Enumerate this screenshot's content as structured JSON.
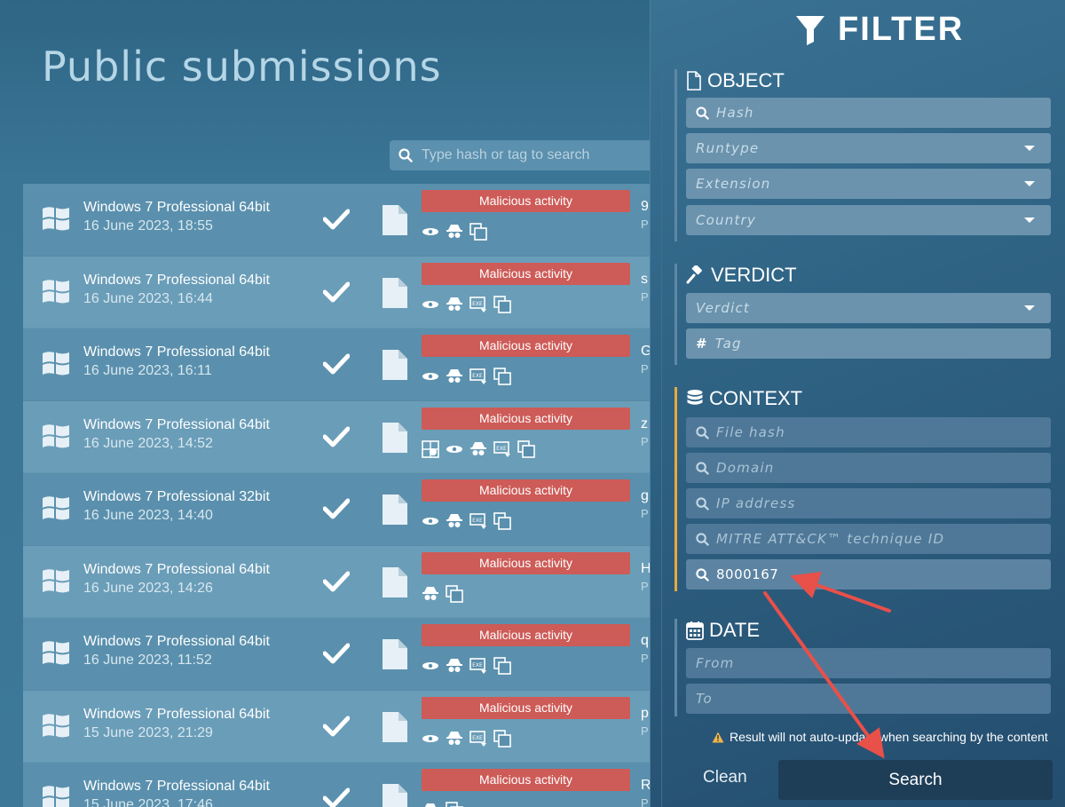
{
  "page": {
    "title": "Public submissions",
    "search_placeholder": "Type hash or tag to search"
  },
  "submissions": [
    {
      "os": "Windows 7 Professional 64bit",
      "date": "16 June 2023, 18:55",
      "verdict": "Malicious activity",
      "name_prefix": "9",
      "sub_prefix": "P",
      "tags": [
        "eye-icon",
        "spy-icon",
        "copy-icon"
      ]
    },
    {
      "os": "Windows 7 Professional 64bit",
      "date": "16 June 2023, 16:44",
      "verdict": "Malicious activity",
      "name_prefix": "s",
      "sub_prefix": "P",
      "tags": [
        "eye-icon",
        "spy-icon",
        "exe-icon",
        "copy-icon"
      ]
    },
    {
      "os": "Windows 7 Professional 64bit",
      "date": "16 June 2023, 16:11",
      "verdict": "Malicious activity",
      "name_prefix": "G",
      "sub_prefix": "P",
      "tags": [
        "eye-icon",
        "spy-icon",
        "exe-icon",
        "copy-icon"
      ]
    },
    {
      "os": "Windows 7 Professional 64bit",
      "date": "16 June 2023, 14:52",
      "verdict": "Malicious activity",
      "name_prefix": "z",
      "sub_prefix": "P",
      "tags": [
        "network-icon",
        "eye-icon",
        "spy-icon",
        "exe-icon",
        "copy-icon"
      ]
    },
    {
      "os": "Windows 7 Professional 32bit",
      "date": "16 June 2023, 14:40",
      "verdict": "Malicious activity",
      "name_prefix": "g",
      "sub_prefix": "P",
      "tags": [
        "eye-icon",
        "spy-icon",
        "exe-icon",
        "copy-icon"
      ]
    },
    {
      "os": "Windows 7 Professional 64bit",
      "date": "16 June 2023, 14:26",
      "verdict": "Malicious activity",
      "name_prefix": "H",
      "sub_prefix": "P",
      "tags": [
        "spy-icon",
        "copy-icon"
      ]
    },
    {
      "os": "Windows 7 Professional 64bit",
      "date": "16 June 2023, 11:52",
      "verdict": "Malicious activity",
      "name_prefix": "q",
      "sub_prefix": "P",
      "tags": [
        "eye-icon",
        "spy-icon",
        "exe-icon",
        "copy-icon"
      ]
    },
    {
      "os": "Windows 7 Professional 64bit",
      "date": "15 June 2023, 21:29",
      "verdict": "Malicious activity",
      "name_prefix": "p",
      "sub_prefix": "P",
      "tags": [
        "eye-icon",
        "spy-icon",
        "exe-icon",
        "copy-icon"
      ]
    },
    {
      "os": "Windows 7 Professional 64bit",
      "date": "15 June 2023, 17:46",
      "verdict": "Malicious activity",
      "name_prefix": "R",
      "sub_prefix": "P",
      "tags": [
        "spy-icon",
        "copy-icon"
      ]
    }
  ],
  "filter": {
    "title": "FILTER",
    "object": {
      "heading": "OBJECT",
      "hash_placeholder": "Hash",
      "runtype_label": "Runtype",
      "extension_label": "Extension",
      "country_label": "Country"
    },
    "verdict": {
      "heading": "VERDICT",
      "verdict_label": "Verdict",
      "tag_placeholder": "Tag"
    },
    "context": {
      "heading": "CONTEXT",
      "file_hash_placeholder": "File hash",
      "domain_placeholder": "Domain",
      "ip_placeholder": "IP address",
      "mitre_placeholder": "MITRE ATT&CK™ technique ID",
      "query_value": "8000167"
    },
    "date": {
      "heading": "DATE",
      "from_placeholder": "From",
      "to_placeholder": "To"
    },
    "warning": "Result will not auto-update when searching by the content",
    "clean_label": "Clean",
    "search_label": "Search"
  },
  "colors": {
    "verdict_badge": "#cd5b57",
    "active_section_bar": "#e9a93b",
    "annotation_arrow": "#e8504a"
  }
}
